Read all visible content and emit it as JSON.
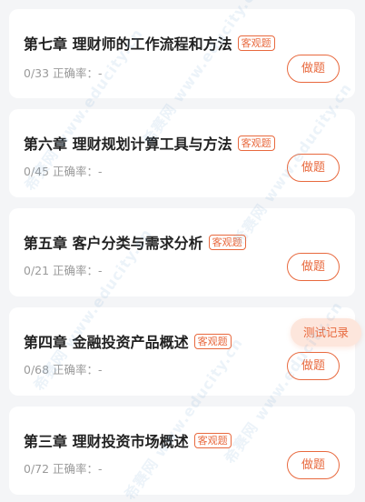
{
  "chapters": [
    {
      "title": "第七章 理财师的工作流程和方法",
      "tag": "客观题",
      "progress_label": "0/33 正确率：-",
      "action_label": "做题"
    },
    {
      "title": "第六章 理财规划计算工具与方法",
      "tag": "客观题",
      "progress_label": "0/45 正确率：-",
      "action_label": "做题"
    },
    {
      "title": "第五章 客户分类与需求分析",
      "tag": "客观题",
      "progress_label": "0/21 正确率：-",
      "action_label": "做题"
    },
    {
      "title": "第四章 金融投资产品概述",
      "tag": "客观题",
      "progress_label": "0/68 正确率：-",
      "action_label": "做题"
    },
    {
      "title": "第三章 理财投资市场概述",
      "tag": "客观题",
      "progress_label": "0/72 正确率：-",
      "action_label": "做题"
    }
  ],
  "record_button": {
    "label": "测试记录"
  },
  "watermark": {
    "text": "希赛网 www.educity.cn"
  },
  "colors": {
    "accent": "#e8693e",
    "background": "#f4f5f7",
    "card": "#ffffff",
    "record_bg": "#fde6dc"
  }
}
